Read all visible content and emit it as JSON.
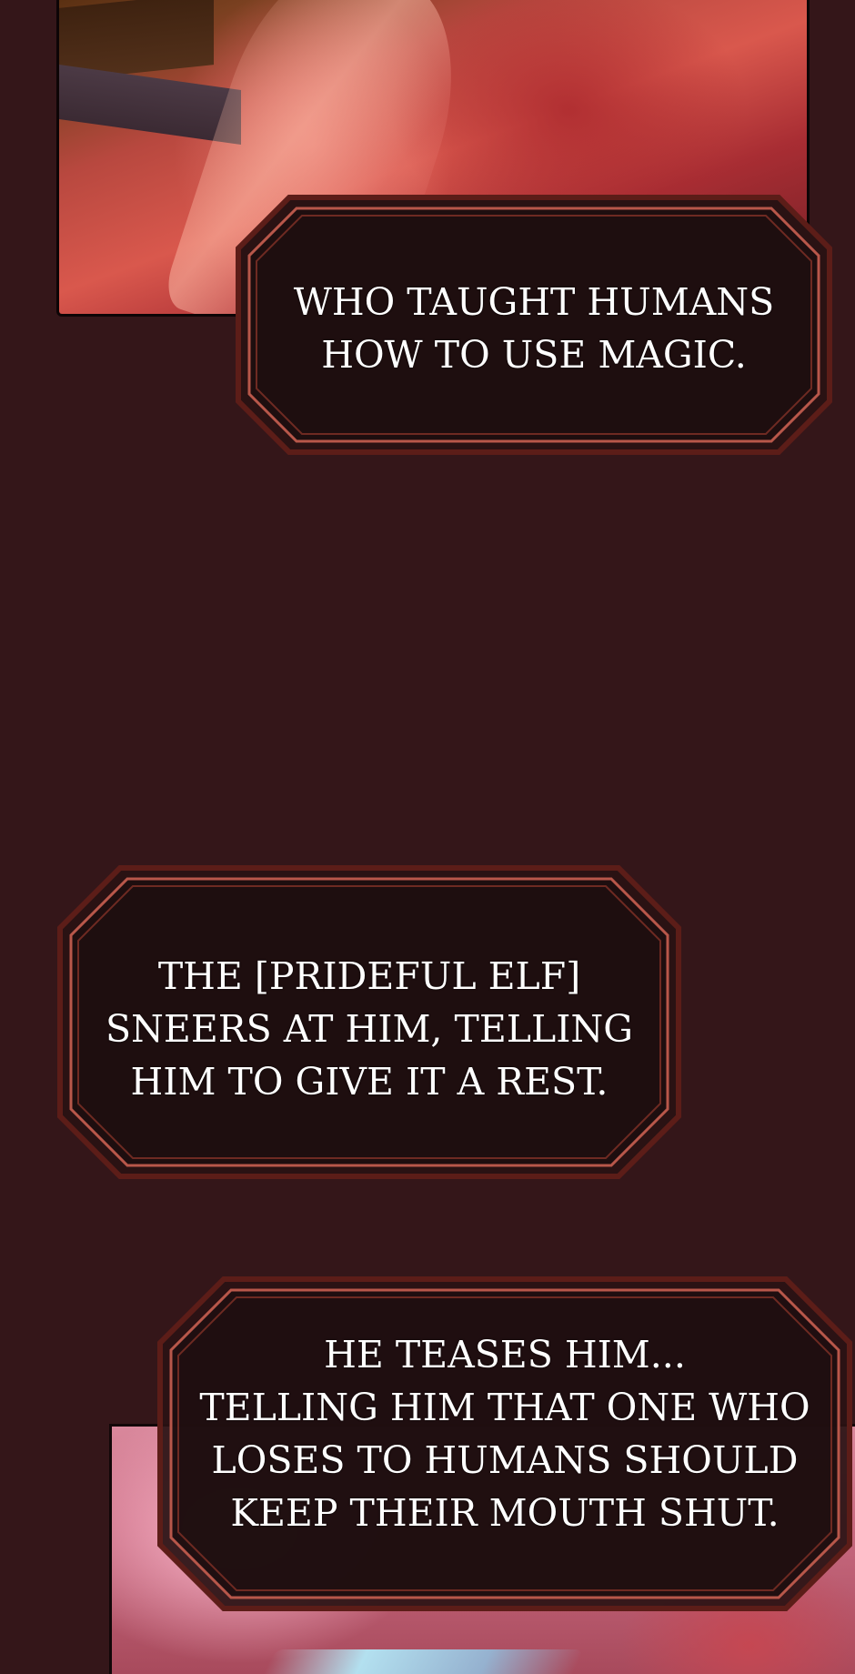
{
  "captions": {
    "top": "WHO TAUGHT HUMANS\nHOW TO USE MAGIC.",
    "middle": "THE [PRIDEFUL ELF]\nSNEERS AT HIM, TELLING\nHIM TO GIVE IT A REST.",
    "bottom": "HE TEASES HIM...\nTELLING HIM THAT ONE WHO\nLOSES TO HUMANS SHOULD\nKEEP THEIR MOUTH SHUT."
  },
  "colors": {
    "page_background": "#341619",
    "caption_fill": "#1e0e0f",
    "caption_border": "#7a2a22",
    "caption_inner_line": "#b8574a",
    "caption_text": "#ffffff"
  }
}
